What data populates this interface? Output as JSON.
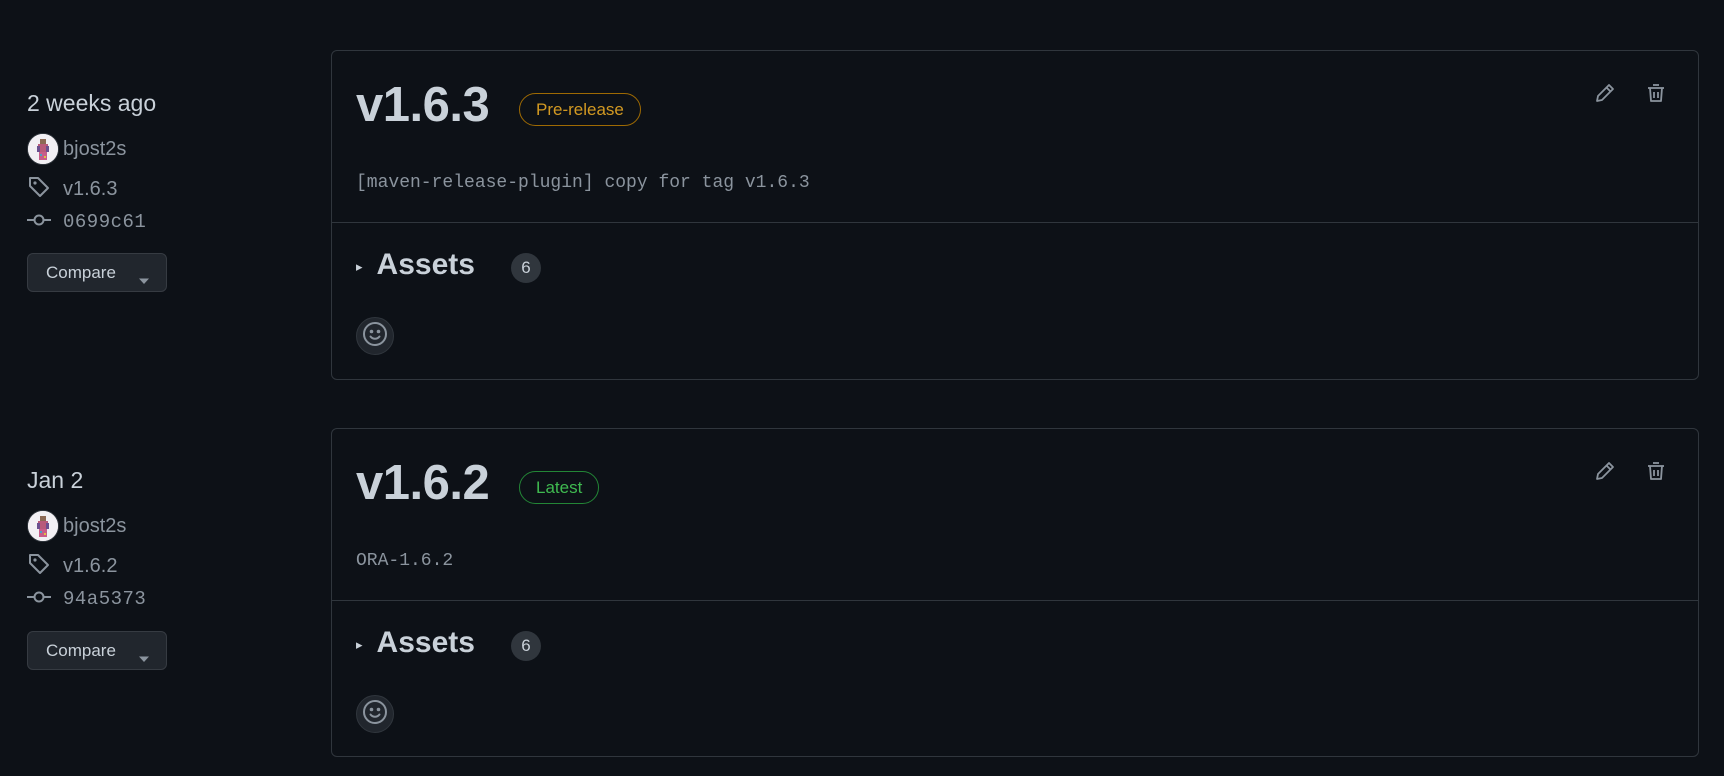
{
  "releases": [
    {
      "date": "2 weeks ago",
      "author": "bjost2s",
      "tag": "v1.6.3",
      "commit": "0699c61",
      "compare_label": "Compare",
      "version": "v1.6.3",
      "badge": "Pre-release",
      "badge_kind": "pre-release",
      "description": "[maven-release-plugin] copy for tag v1.6.3",
      "assets_label": "Assets",
      "assets_count": "6"
    },
    {
      "date": "Jan 2",
      "author": "bjost2s",
      "tag": "v1.6.2",
      "commit": "94a5373",
      "compare_label": "Compare",
      "version": "v1.6.2",
      "badge": "Latest",
      "badge_kind": "latest",
      "description": "ORA-1.6.2",
      "assets_label": "Assets",
      "assets_count": "6"
    }
  ],
  "icons": {
    "edit": "pencil-icon",
    "delete": "trash-icon",
    "tag": "tag-icon",
    "commit": "git-commit-icon",
    "reaction": "smiley-icon",
    "caret": "triangle-down-icon",
    "expand": "triangle-right-icon"
  },
  "colors": {
    "background": "#0d1117",
    "border": "#30363d",
    "text": "#c9d1d9",
    "muted": "#8b949e",
    "pre_release": "#d29922",
    "latest": "#3fb950"
  }
}
